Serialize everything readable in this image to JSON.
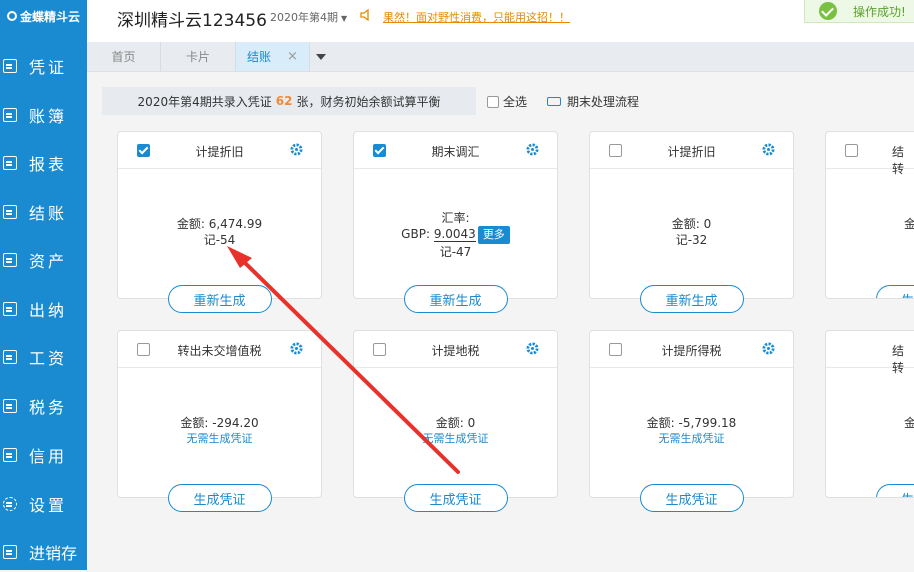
{
  "logo": {
    "text": "金蝶精斗云"
  },
  "sidebar": {
    "items": [
      {
        "label": "凭证"
      },
      {
        "label": "账簿"
      },
      {
        "label": "报表"
      },
      {
        "label": "结账"
      },
      {
        "label": "资产"
      },
      {
        "label": "出纳"
      },
      {
        "label": "工资"
      },
      {
        "label": "税务"
      },
      {
        "label": "信用"
      },
      {
        "label": "设置"
      },
      {
        "label": "进销存"
      }
    ]
  },
  "header": {
    "company": "深圳精斗云123456",
    "period": "2020年第4期",
    "notice": "果然！面对野性消费，只能用这招！！"
  },
  "toast": {
    "text": "操作成功!"
  },
  "tabs": [
    {
      "label": "首页"
    },
    {
      "label": "卡片"
    },
    {
      "label": "结账",
      "close": "×"
    }
  ],
  "summary": {
    "prefix": "2020年第4期共录入凭证",
    "count": "62",
    "suffix": "张，财务初始余额试算平衡"
  },
  "selectall": {
    "label": "全选"
  },
  "process": {
    "label": "期末处理流程"
  },
  "cards": [
    {
      "title": "计提折旧",
      "checked": true,
      "line1": "金额:  6,474.99",
      "line2": "记-54",
      "button": "重新生成"
    },
    {
      "title": "期末调汇",
      "checked": true,
      "fx_label": "汇率:",
      "fx_currency": "GBP:",
      "fx_rate": "9.0043",
      "fx_more": "更多",
      "line2": "记-47",
      "button": "重新生成"
    },
    {
      "title": "计提折旧",
      "checked": false,
      "line1": "金额:  0",
      "line2": "记-32",
      "button": "重新生成"
    },
    {
      "title": "结转",
      "checked": false,
      "line1": "金",
      "button": "生"
    },
    {
      "title": "转出未交增值税",
      "checked": false,
      "line1": "金额:  -294.20",
      "line2": "无需生成凭证",
      "button": "生成凭证"
    },
    {
      "title": "计提地税",
      "checked": false,
      "line1": "金额:  0",
      "line2": "无需生成凭证",
      "button": "生成凭证"
    },
    {
      "title": "计提所得税",
      "checked": false,
      "line1": "金额:  -5,799.18",
      "line2": "无需生成凭证",
      "button": "生成凭证"
    },
    {
      "title": "结转",
      "checked": false,
      "line1": "金",
      "button": "生"
    }
  ],
  "colors": {
    "accent": "#1a8bd1",
    "arrow": "#e8312a",
    "warn": "#e68a00",
    "success": "#7ac043"
  }
}
